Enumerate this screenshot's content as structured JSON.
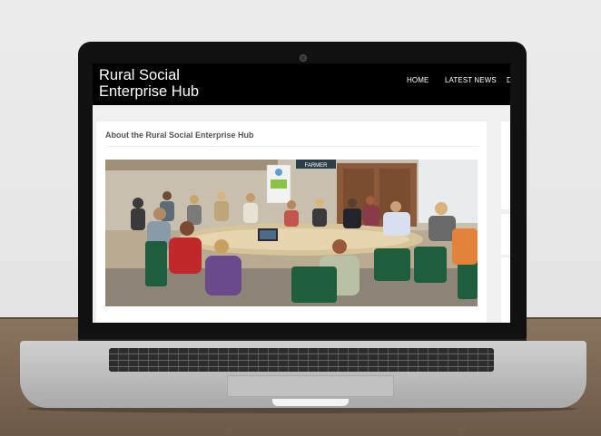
{
  "site": {
    "title_line1": "Rural Social",
    "title_line2": "Enterprise Hub",
    "nav": [
      "HOME",
      "LATEST NEWS",
      "D"
    ]
  },
  "main": {
    "heading": "About the Rural Social Enterprise Hub",
    "photo_sign": "FARMER",
    "photo_banner_icon": "logo-icon"
  },
  "colors": {
    "header_bg": "#000000",
    "content_bg": "#ffffff",
    "page_bg": "#f0f0f0"
  }
}
